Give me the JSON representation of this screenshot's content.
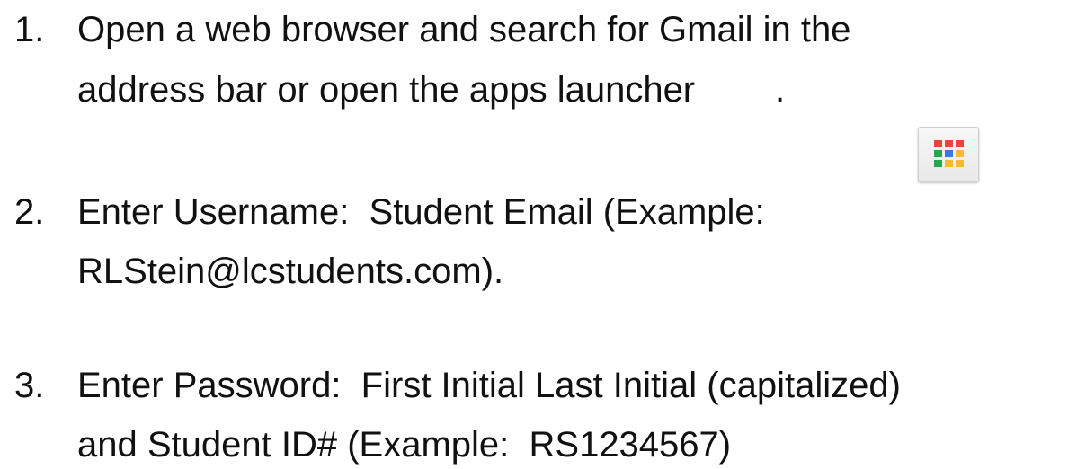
{
  "steps": [
    {
      "number": "1.",
      "lines": [
        "Open a web browser and search for Gmail in the",
        "address bar or open the apps launcher        ."
      ]
    },
    {
      "number": "2.",
      "lines": [
        "Enter Username:  Student Email (Example:",
        "RLStein@lcstudents.com)."
      ]
    },
    {
      "number": "3.",
      "lines": [
        "Enter Password:  First Initial Last Initial (capitalized)",
        "and Student ID# (Example:  RS1234567)"
      ]
    }
  ],
  "apps_icon": {
    "icon": "apps-launcher-icon",
    "colors": [
      "#e8453c",
      "#e8453c",
      "#e8453c",
      "#2aa54b",
      "#3b78e7",
      "#f9bb2d",
      "#2aa54b",
      "#f9bb2d",
      "#f9bb2d"
    ]
  }
}
